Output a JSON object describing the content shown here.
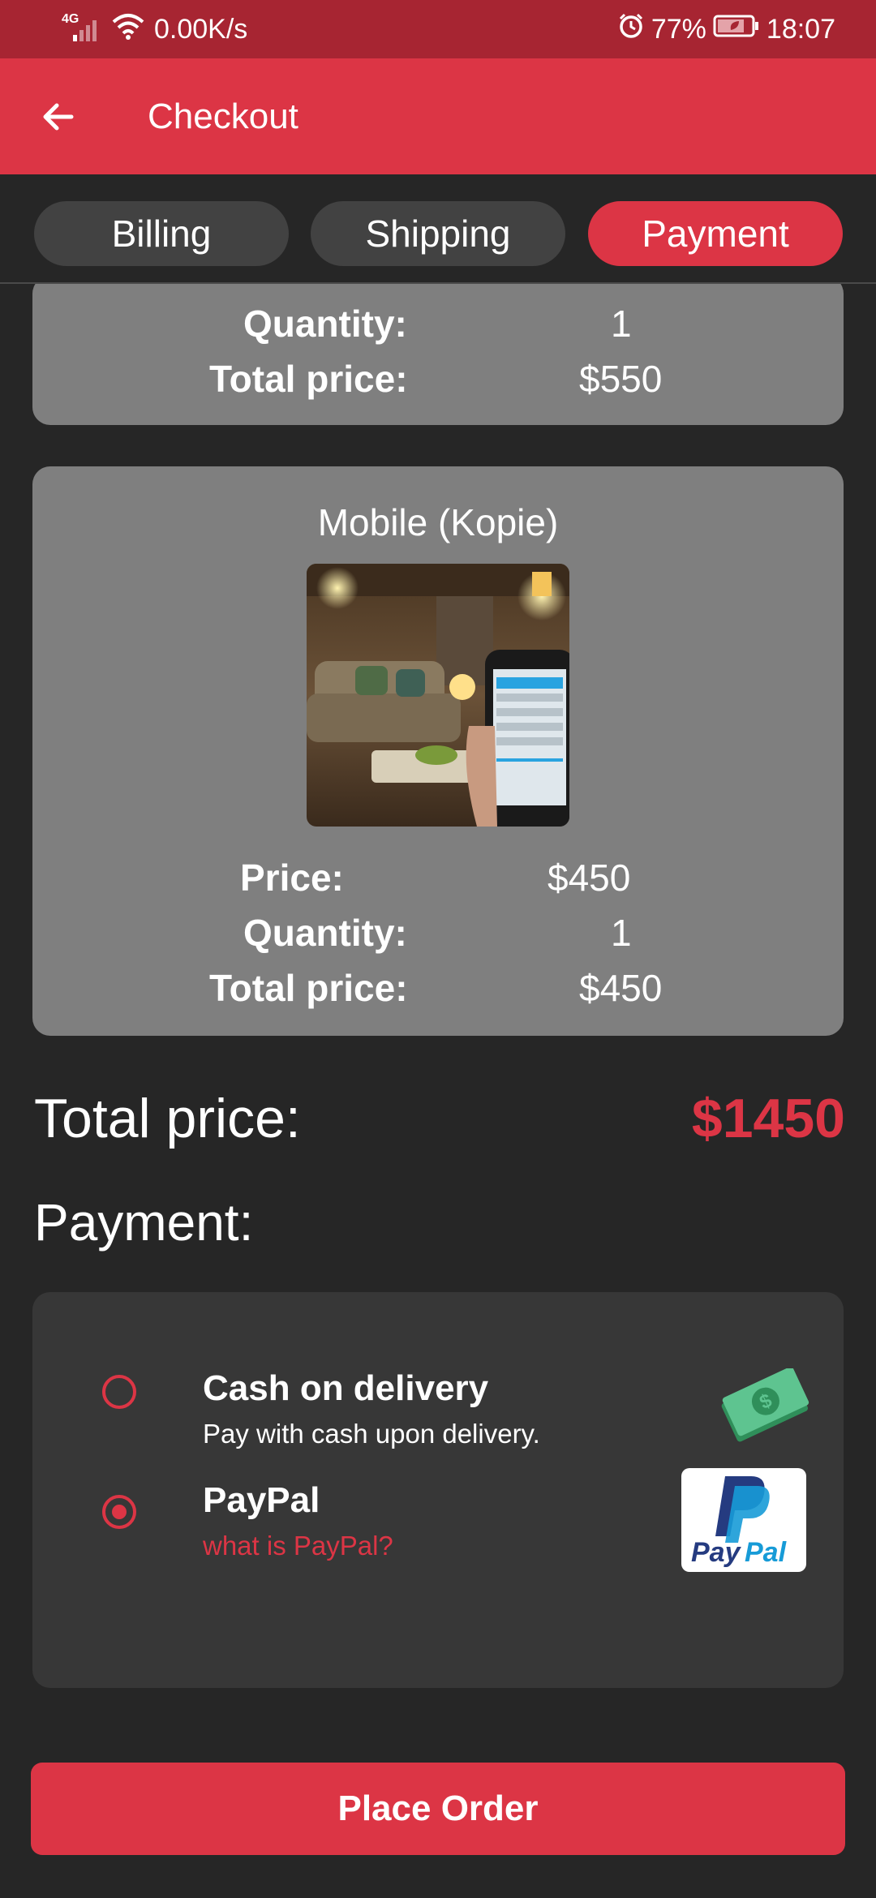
{
  "status_bar": {
    "network": "4G",
    "speed": "0.00K/s",
    "battery": "77%",
    "time": "18:07"
  },
  "app_bar": {
    "title": "Checkout",
    "back_icon": "arrow-back-icon"
  },
  "tabs": [
    {
      "label": "Billing",
      "active": false
    },
    {
      "label": "Shipping",
      "active": false
    },
    {
      "label": "Payment",
      "active": true
    }
  ],
  "items": [
    {
      "quantity_label": "Quantity:",
      "quantity": "1",
      "total_label": "Total price:",
      "total": "$550"
    },
    {
      "name": "Mobile (Kopie)",
      "price_label": "Price:",
      "price": "$450",
      "quantity_label": "Quantity:",
      "quantity": "1",
      "total_label": "Total price:",
      "total": "$450"
    }
  ],
  "summary": {
    "total_label": "Total price:",
    "total": "$1450"
  },
  "payment": {
    "heading": "Payment:",
    "options": [
      {
        "title": "Cash on delivery",
        "subtitle": "Pay with cash upon delivery.",
        "selected": false,
        "icon": "cash-icon"
      },
      {
        "title": "PayPal",
        "subtitle": "what is PayPal?",
        "selected": true,
        "icon": "paypal-logo"
      }
    ]
  },
  "place_order": "Place Order",
  "colors": {
    "accent": "#dc3545",
    "statusbar": "#a72532",
    "background": "#262626",
    "card": "#7f7f7f",
    "payment_card": "#373737"
  }
}
